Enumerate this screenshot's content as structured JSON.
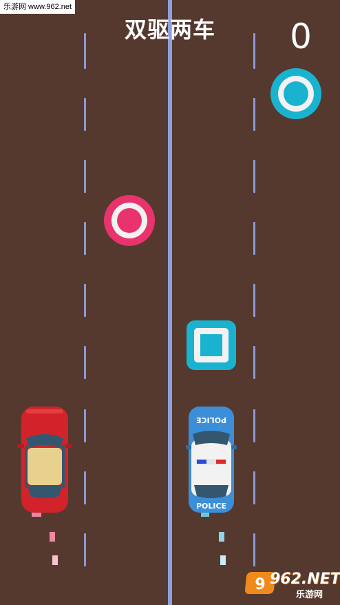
{
  "watermark_top": "乐游网 www.962.net",
  "title": "双驱两车",
  "score": "0",
  "colors": {
    "road": "#55392e",
    "divider": "#8f9fdc",
    "left_accent": "#e8336d",
    "right_accent": "#1ab3cf"
  },
  "left_car": {
    "type": "red-car"
  },
  "right_car": {
    "type": "police-car",
    "roof_text": "POLICE",
    "hood_text": "POLICE"
  },
  "objects": [
    {
      "type": "circle",
      "lane": "right-right",
      "color": "cyan"
    },
    {
      "type": "circle",
      "lane": "left-right",
      "color": "pink"
    },
    {
      "type": "square",
      "lane": "right-left",
      "color": "cyan"
    }
  ],
  "watermark_bottom": {
    "brand": "962.NET",
    "subtitle": "乐游网"
  }
}
